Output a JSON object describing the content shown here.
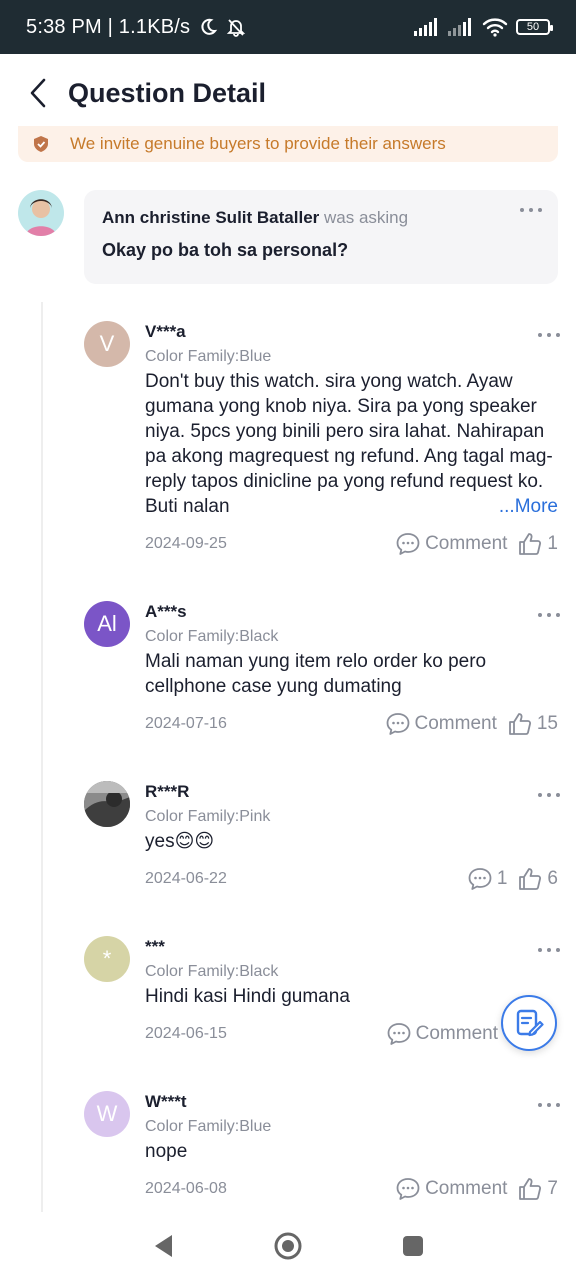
{
  "status_bar": {
    "time_speed": "5:38 PM | 1.1KB/s",
    "battery": "50"
  },
  "header": {
    "title": "Question Detail"
  },
  "banner": {
    "text": "We invite genuine buyers to provide their answers"
  },
  "question": {
    "asker": "Ann christine Sulit Bataller",
    "verb": "was asking",
    "text": "Okay po ba toh sa personal?"
  },
  "answers": [
    {
      "initial": "V",
      "avatar_color": "#d4b8aa",
      "name": "V***a",
      "variant": "Color Family:Blue",
      "text": "Don't buy this watch. sira yong watch. Ayaw gumana yong knob niya. Sira pa yong speaker niya. 5pcs yong binili pero sira lahat. Nahirapan pa akong magrequest ng refund. Ang tagal mag-reply tapos dinicline pa yong refund request ko. Buti nalan",
      "more": "...More",
      "date": "2024-09-25",
      "comment": "Comment",
      "likes": "1"
    },
    {
      "initial": "Al",
      "avatar_color": "#7b55c7",
      "name": "A***s",
      "variant": "Color Family:Black",
      "text": "Mali naman yung item relo order ko pero cellphone case yung dumating",
      "date": "2024-07-16",
      "comment": "Comment",
      "likes": "15"
    },
    {
      "initial": "",
      "avatar_color": "#5a5a5a",
      "name": "R***R",
      "variant": "Color Family:Pink",
      "text": "yes😊😊",
      "date": "2024-06-22",
      "comment": "1",
      "likes": "6"
    },
    {
      "initial": "*",
      "avatar_color": "#d6d4a6",
      "name": "***",
      "variant": "Color Family:Black",
      "text": "Hindi kasi Hindi gumana",
      "date": "2024-06-15",
      "comment": "Comment",
      "likes": ""
    },
    {
      "initial": "W",
      "avatar_color": "#d9c6ee",
      "name": "W***t",
      "variant": "Color Family:Blue",
      "text": "nope",
      "date": "2024-06-08",
      "comment": "Comment",
      "likes": "7"
    }
  ],
  "colors": {
    "accent_link": "#2a6fdb",
    "banner_text": "#c67a2a",
    "status_bar": "#1f2c33"
  }
}
